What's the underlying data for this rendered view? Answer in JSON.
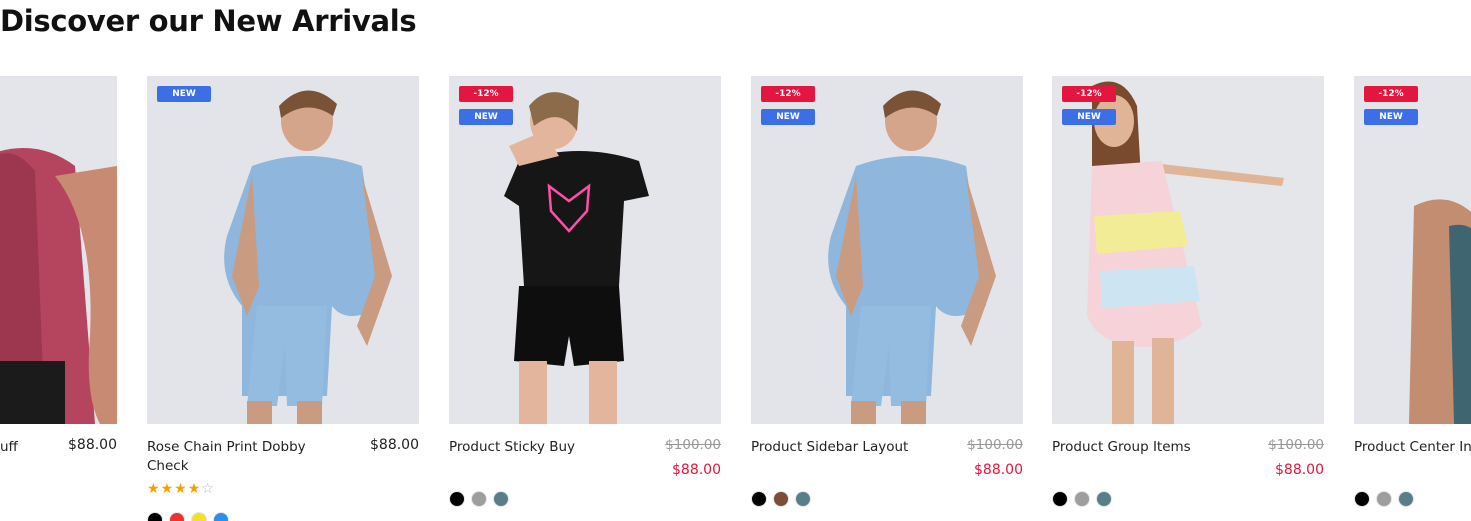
{
  "section": {
    "title": "Discover our New Arrivals"
  },
  "products": [
    {
      "title": "uff",
      "price": "$88.00",
      "swatches": []
    },
    {
      "title": "Rose Chain Print Dobby Check",
      "price": "$88.00",
      "badges": [
        "NEW"
      ],
      "rating": 4,
      "rating_max": 5,
      "swatches": [
        "#000000",
        "#e8342f",
        "#f1e02a",
        "#2e8ee8"
      ]
    },
    {
      "title": "Product Sticky Buy",
      "old_price": "$100.00",
      "price": "$88.00",
      "badges": [
        "-12%",
        "NEW"
      ],
      "swatches": [
        "#000000",
        "#9e9e9e",
        "#5a7d8a"
      ]
    },
    {
      "title": "Product Sidebar Layout",
      "old_price": "$100.00",
      "price": "$88.00",
      "badges": [
        "-12%",
        "NEW"
      ],
      "swatches": [
        "#000000",
        "#7a4f3a",
        "#5a7d8a"
      ]
    },
    {
      "title": "Product Group Items",
      "old_price": "$100.00",
      "price": "$88.00",
      "badges": [
        "-12%",
        "NEW"
      ],
      "swatches": [
        "#000000",
        "#9e9e9e",
        "#5a7d8a"
      ]
    },
    {
      "title": "Product Center In",
      "badges": [
        "-12%",
        "NEW"
      ],
      "swatches": [
        "#000000",
        "#9e9e9e",
        "#5a7d8a"
      ]
    }
  ],
  "colors": {
    "sale_badge": "#e3163f",
    "new_badge": "#3c6fe6",
    "sale_price": "#e3163f",
    "star": "#f5a100"
  }
}
